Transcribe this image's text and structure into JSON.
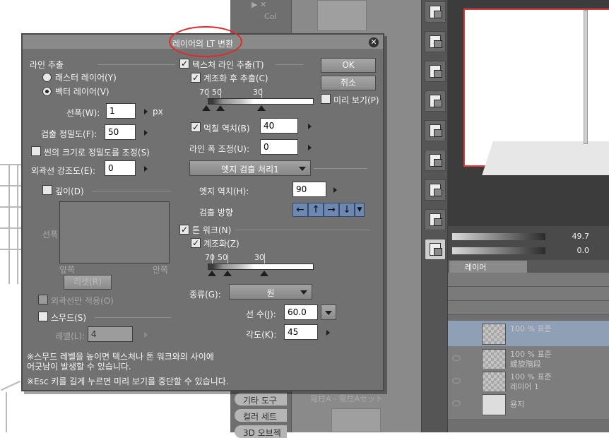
{
  "background": {
    "mid_tabs": [
      "기타 도구",
      "컬러 세트",
      "3D 오브젝"
    ],
    "mid_ghost": [
      "Col",
      "電柱A - 電柱Aセット",
      "ット",
      "ット"
    ],
    "nav": {
      "zoom": "49.7",
      "rotate": "0.0"
    },
    "layer_tab": "레이어",
    "layers": [
      {
        "pct": "100 % 표준",
        "name": ""
      },
      {
        "pct": "100 % 표준",
        "name": "螺旋階段"
      },
      {
        "pct": "100 % 표준",
        "name": "레이어 1"
      },
      {
        "pct": "",
        "name": "용지"
      }
    ]
  },
  "dialog": {
    "title": "레이어의 LT 변환",
    "left": {
      "line_extract": "라인 추출",
      "raster_layer": "래스터 레이어(Y)",
      "vector_layer": "벡터 레이어(V)",
      "line_width_label": "선폭(W):",
      "line_width": "1",
      "line_width_unit": "px",
      "detect_precision_label": "검출 정밀도(F):",
      "detect_precision": "50",
      "scene_size_precision": "씬의 크기로 정밀도를 조정(S)",
      "outline_strength_label": "외곽선 강조도(E):",
      "outline_strength": "0",
      "depth": "깊이(D)",
      "width_axis": "선폭",
      "front": "앞쪽",
      "back": "안쪽",
      "reset": "리셋(R)",
      "outline_only": "외곽선만 적용(O)",
      "smooth": "스무드(S)",
      "level_label": "레벨(L):",
      "level": "4"
    },
    "right": {
      "texture_line_extract": "텍스처 라인 추출(T)",
      "extract_after_posterize": "계조화 후 추출(C)",
      "slider1_ticks": [
        "70",
        "50",
        "30"
      ],
      "fill_threshold_label": "먹칠 역치(B)",
      "fill_threshold": "40",
      "line_width_adjust_label": "라인 폭 조정(U):",
      "line_width_adjust": "0",
      "edge_mode": "엣지 검출 처리1",
      "edge_threshold_label": "엣지 역치(H):",
      "edge_threshold": "90",
      "detect_direction_label": "검출 방향",
      "directions": [
        "←",
        "↑",
        "→",
        "↓"
      ],
      "tone_work": "톤 워크(N)",
      "posterize": "계조화(Z)",
      "slider2_ticks": [
        "70",
        "50",
        "30"
      ],
      "type_label": "종류(G):",
      "type_value": "원",
      "line_count_label": "선 수(J):",
      "line_count": "60.0",
      "angle_label": "각도(K):",
      "angle": "45"
    },
    "buttons": {
      "ok": "OK",
      "cancel": "취소",
      "preview": "미리 보기(P)"
    },
    "notes": [
      "※스무드 레벨을 높이면 텍스처나 톤 워크와의 사이에",
      " 어긋남이 발생할 수 있습니다.",
      "※Esc 키를 길게 누르면 미리 보기를 중단할 수 있습니다."
    ],
    "colors": {
      "annotation": "#e02a2a",
      "panel": "#717171",
      "accent": "#6d89b1"
    }
  }
}
